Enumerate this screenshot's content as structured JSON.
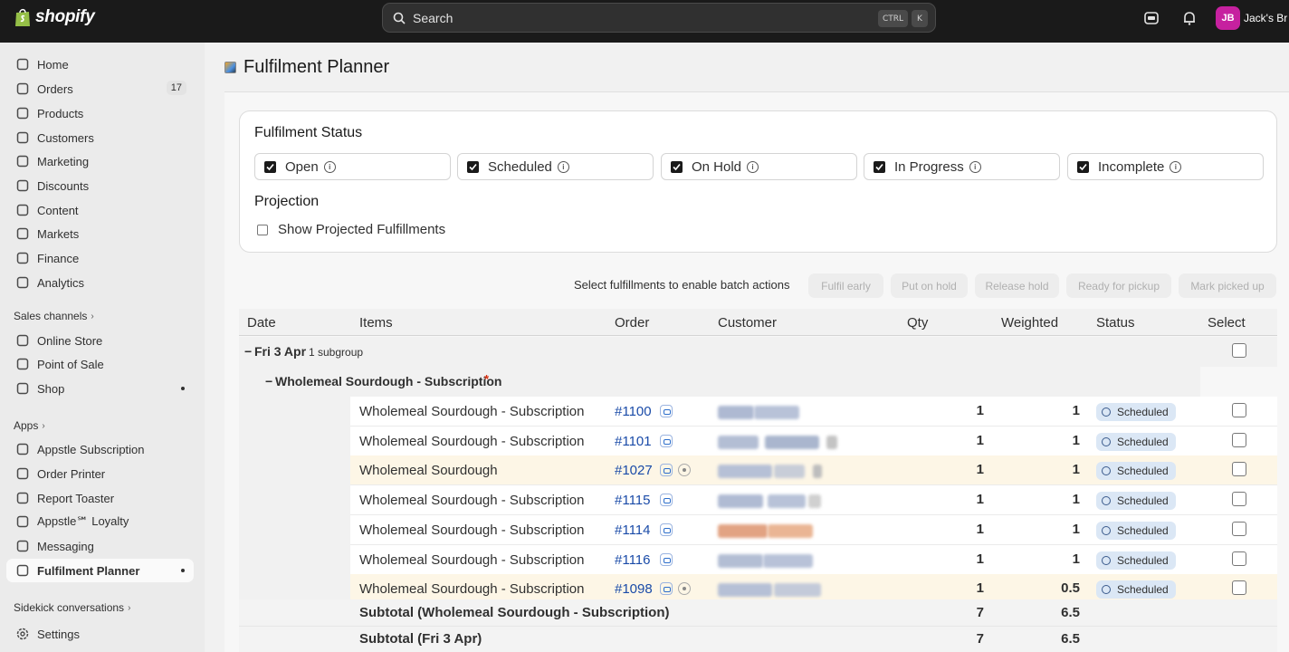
{
  "topbar": {
    "brand": "shopify",
    "search_placeholder": "Search",
    "shortcut_ctrl": "CTRL",
    "shortcut_k": "K",
    "avatar_initials": "JB",
    "user_name": "Jack's Br"
  },
  "sidebar": {
    "main_items": [
      {
        "label": "Home",
        "icon": "home-icon"
      },
      {
        "label": "Orders",
        "icon": "orders-icon",
        "badge": "17"
      },
      {
        "label": "Products",
        "icon": "tag-icon"
      },
      {
        "label": "Customers",
        "icon": "person-icon"
      },
      {
        "label": "Marketing",
        "icon": "target-icon"
      },
      {
        "label": "Discounts",
        "icon": "discount-icon"
      },
      {
        "label": "Content",
        "icon": "content-icon"
      },
      {
        "label": "Markets",
        "icon": "globe-icon"
      },
      {
        "label": "Finance",
        "icon": "bank-icon"
      },
      {
        "label": "Analytics",
        "icon": "chart-icon"
      }
    ],
    "sales_channels_heading": "Sales channels",
    "sales_channels": [
      {
        "label": "Online Store",
        "icon": "store-icon"
      },
      {
        "label": "Point of Sale",
        "icon": "pos-icon"
      },
      {
        "label": "Shop",
        "icon": "shop-icon"
      }
    ],
    "apps_heading": "Apps",
    "apps": [
      {
        "label": "Appstle Subscription",
        "icon": "app-icon"
      },
      {
        "label": "Order Printer",
        "icon": "app-icon"
      },
      {
        "label": "Report Toaster",
        "icon": "app-icon"
      },
      {
        "label": "Appstle℠ Loyalty",
        "icon": "app-icon"
      },
      {
        "label": "Messaging",
        "icon": "app-icon"
      },
      {
        "label": "Fulfilment Planner",
        "icon": "app-icon"
      }
    ],
    "sidekick_heading": "Sidekick conversations",
    "settings_label": "Settings"
  },
  "page": {
    "title": "Fulfilment Planner"
  },
  "filters": {
    "status_heading": "Fulfilment Status",
    "statuses": [
      "Open",
      "Scheduled",
      "On Hold",
      "In Progress",
      "Incomplete"
    ],
    "projection_heading": "Projection",
    "projection_label": "Show Projected Fulfillments"
  },
  "batch": {
    "prompt": "Select fulfillments to enable batch actions",
    "buttons": [
      "Fulfil early",
      "Put on hold",
      "Release hold",
      "Ready for pickup",
      "Mark picked up"
    ]
  },
  "table": {
    "columns": [
      "Date",
      "Items",
      "Order",
      "Customer",
      "Qty",
      "Weighted",
      "Status",
      "Select"
    ],
    "date_group": {
      "label": "Fri 3 Apr",
      "sub": "1 subgroup",
      "toggle": "−"
    },
    "item_group": {
      "label": "Wholemeal Sourdough - Subscription",
      "marker": "*",
      "toggle": "−"
    },
    "rows": [
      {
        "item": "Wholemeal Sourdough - Subscription",
        "order": "#1100",
        "qty": "1",
        "weighted": "1",
        "status": "Scheduled",
        "note": false,
        "highlight": false
      },
      {
        "item": "Wholemeal Sourdough - Subscription",
        "order": "#1101",
        "qty": "1",
        "weighted": "1",
        "status": "Scheduled",
        "note": false,
        "highlight": false
      },
      {
        "item": "Wholemeal Sourdough",
        "order": "#1027",
        "qty": "1",
        "weighted": "1",
        "status": "Scheduled",
        "note": true,
        "highlight": true
      },
      {
        "item": "Wholemeal Sourdough - Subscription",
        "order": "#1115",
        "qty": "1",
        "weighted": "1",
        "status": "Scheduled",
        "note": false,
        "highlight": false
      },
      {
        "item": "Wholemeal Sourdough - Subscription",
        "order": "#1114",
        "qty": "1",
        "weighted": "1",
        "status": "Scheduled",
        "note": false,
        "highlight": false
      },
      {
        "item": "Wholemeal Sourdough - Subscription",
        "order": "#1116",
        "qty": "1",
        "weighted": "1",
        "status": "Scheduled",
        "note": false,
        "highlight": false
      },
      {
        "item": "Wholemeal Sourdough - Subscription",
        "order": "#1098",
        "qty": "1",
        "weighted": "0.5",
        "status": "Scheduled",
        "note": true,
        "highlight": true
      }
    ],
    "subtotals": [
      {
        "label": "Subtotal (Wholemeal Sourdough - Subscription)",
        "qty": "7",
        "weighted": "6.5"
      },
      {
        "label": "Subtotal (Fri 3 Apr)",
        "qty": "7",
        "weighted": "6.5"
      }
    ]
  },
  "colors": {
    "topbar": "#1a1a1a",
    "link": "#1a4ba8",
    "status_pill": "#dbe7f5",
    "row_highlight": "#fdf6e6",
    "avatar": "#c6219f"
  }
}
